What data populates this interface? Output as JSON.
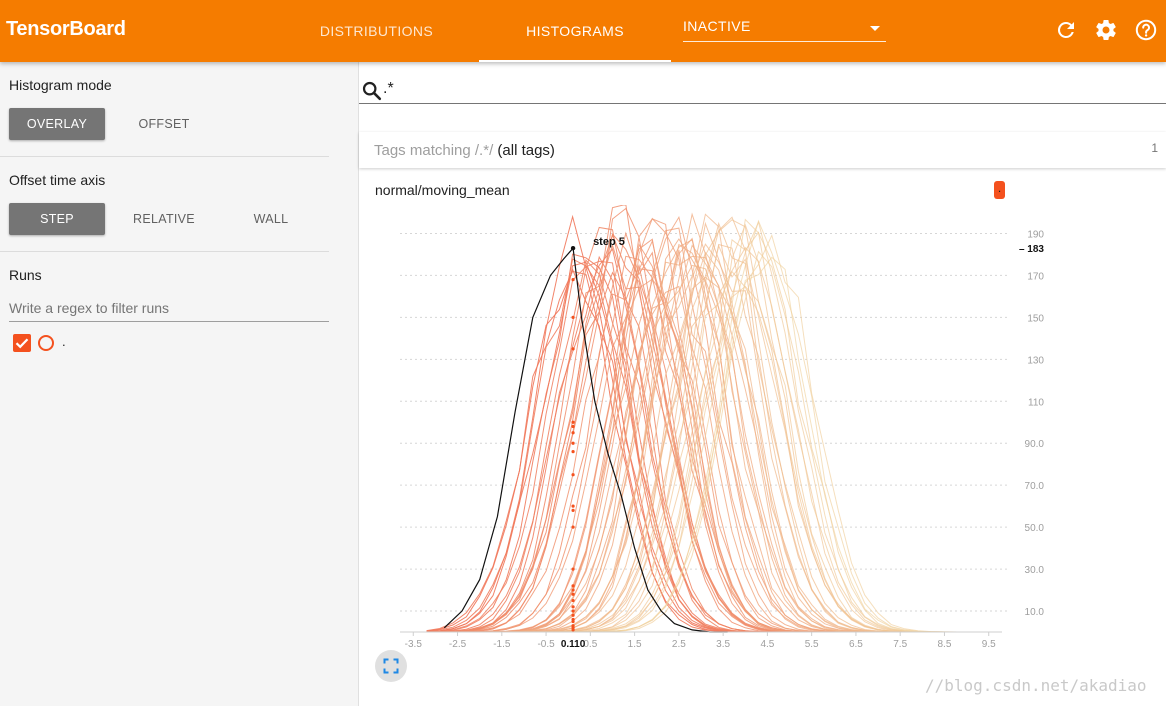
{
  "app": {
    "title": "TensorBoard",
    "accent_color": "#f57c00",
    "tabs": [
      {
        "label": "DISTRIBUTIONS",
        "selected": false
      },
      {
        "label": "HISTOGRAMS",
        "selected": true
      }
    ],
    "inactive_dropdown": {
      "selected": "INACTIVE"
    },
    "actions": [
      "refresh-icon",
      "settings-icon",
      "help-icon"
    ]
  },
  "sidebar": {
    "histogram_mode": {
      "title": "Histogram mode",
      "options": [
        "OVERLAY",
        "OFFSET"
      ],
      "selected": "OVERLAY"
    },
    "offset_time_axis": {
      "title": "Offset time axis",
      "options": [
        "STEP",
        "RELATIVE",
        "WALL"
      ],
      "selected": "STEP"
    },
    "runs": {
      "title": "Runs",
      "filter_placeholder": "Write a regex to filter runs",
      "items": [
        {
          "name": ".",
          "checked": true,
          "color": "#f4511e"
        }
      ]
    }
  },
  "main": {
    "search": {
      "value": ".*",
      "icon": "search-icon"
    },
    "tags": {
      "prefix": "Tags matching",
      "regex": "/.*/",
      "suffix": "(all tags)",
      "count": "1"
    },
    "card": {
      "title": "normal/moving_mean",
      "run_badge": "."
    }
  },
  "chart_data": {
    "type": "line",
    "title": "normal/moving_mean",
    "xlim": [
      -3.8,
      9.8
    ],
    "ylim": [
      0,
      195
    ],
    "x_ticks": [
      "-3.5",
      "-2.5",
      "-1.5",
      "-0.5",
      "0.5",
      "1.5",
      "2.5",
      "3.5",
      "4.5",
      "5.5",
      "6.5",
      "7.5",
      "8.5",
      "9.5"
    ],
    "y_ticks": [
      "10.0",
      "30.0",
      "50.0",
      "70.0",
      "90.0",
      "110",
      "130",
      "150",
      "170",
      "190"
    ],
    "series_color": "#f4511e",
    "hover": {
      "step_label": "step 5",
      "x_label": "0.110",
      "y_label": "183",
      "x": 0.11,
      "y": 183
    },
    "highlight": {
      "x": [
        -2.8,
        -2.4,
        -2.0,
        -1.6,
        -1.2,
        -0.8,
        -0.4,
        -0.1,
        0.11,
        0.3,
        0.6,
        0.9,
        1.2,
        1.5,
        1.8,
        2.1,
        2.4,
        2.8,
        3.2,
        3.6
      ],
      "y": [
        2,
        10,
        25,
        55,
        105,
        150,
        170,
        178,
        183,
        150,
        110,
        85,
        65,
        40,
        20,
        10,
        4,
        1,
        0,
        0
      ]
    },
    "steps_overlay": {
      "count": 60,
      "peak_range": [
        170,
        195
      ],
      "mean_range": [
        0.1,
        4.6
      ],
      "std_range": [
        0.85,
        1.05
      ]
    },
    "marker_x": 0.11,
    "marker_y": [
      183,
      168,
      150,
      135,
      100,
      98,
      95,
      90,
      86,
      75,
      60,
      58,
      50,
      30,
      22,
      20,
      18,
      15,
      12,
      10,
      8,
      6,
      5,
      3,
      2,
      1
    ]
  }
}
